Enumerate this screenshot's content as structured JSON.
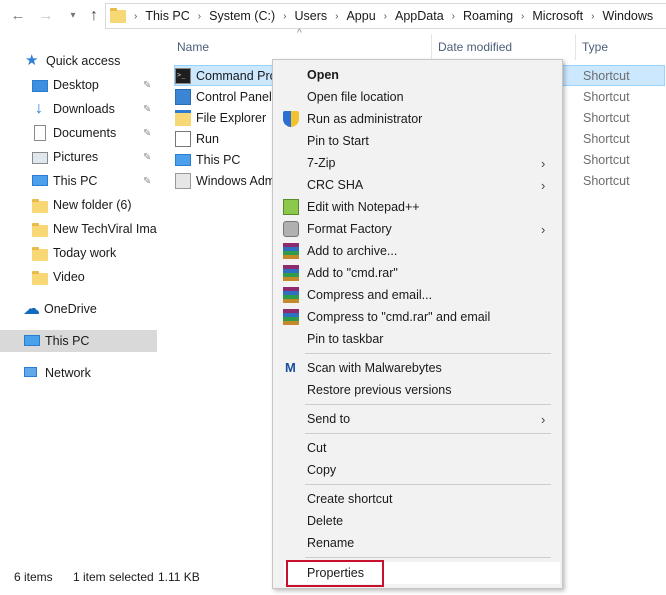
{
  "breadcrumb": [
    "This PC",
    "System (C:)",
    "Users",
    "Appu",
    "AppData",
    "Roaming",
    "Microsoft",
    "Windows"
  ],
  "sidebar": {
    "quick_access": "Quick access",
    "items": [
      {
        "label": "Desktop",
        "pinned": true
      },
      {
        "label": "Downloads",
        "pinned": true
      },
      {
        "label": "Documents",
        "pinned": true
      },
      {
        "label": "Pictures",
        "pinned": true
      },
      {
        "label": "This PC",
        "pinned": true
      },
      {
        "label": "New folder (6)",
        "pinned": false
      },
      {
        "label": "New TechViral Imag",
        "pinned": false
      },
      {
        "label": "Today work",
        "pinned": false
      },
      {
        "label": "Video",
        "pinned": false
      }
    ],
    "onedrive": "OneDrive",
    "this_pc": "This PC",
    "network": "Network"
  },
  "columns": {
    "name": "Name",
    "date_modified": "Date modified",
    "type": "Type"
  },
  "files": [
    {
      "name": "Command Prompt",
      "type": "Shortcut",
      "icon": "cmd-icon"
    },
    {
      "name": "Control Panel",
      "type": "Shortcut",
      "icon": "control-panel-icon"
    },
    {
      "name": "File Explorer",
      "type": "Shortcut",
      "icon": "file-explorer-icon"
    },
    {
      "name": "Run",
      "type": "Shortcut",
      "icon": "run-icon"
    },
    {
      "name": "This PC",
      "type": "Shortcut",
      "icon": "this-pc-icon"
    },
    {
      "name": "Windows Administrative Tools",
      "type": "Shortcut",
      "icon": "admin-tools-icon"
    }
  ],
  "context_menu": {
    "open": "Open",
    "open_file_location": "Open file location",
    "run_as_admin": "Run as administrator",
    "pin_to_start": "Pin to Start",
    "seven_zip": "7-Zip",
    "crc_sha": "CRC SHA",
    "edit_npp": "Edit with Notepad++",
    "format_factory": "Format Factory",
    "add_to_archive": "Add to archive...",
    "add_to_cmd_rar": "Add to \"cmd.rar\"",
    "compress_email": "Compress and email...",
    "compress_cmd_email": "Compress to \"cmd.rar\" and email",
    "pin_taskbar": "Pin to taskbar",
    "scan_malwarebytes": "Scan with Malwarebytes",
    "restore_versions": "Restore previous versions",
    "send_to": "Send to",
    "cut": "Cut",
    "copy": "Copy",
    "create_shortcut": "Create shortcut",
    "delete": "Delete",
    "rename": "Rename",
    "properties": "Properties"
  },
  "status": {
    "count": "6 items",
    "selected": "1 item selected",
    "size": "1.11 KB"
  },
  "colors": {
    "highlight_box": "#c8102e",
    "selection": "#cce8ff",
    "accent": "#2b7cd3"
  }
}
